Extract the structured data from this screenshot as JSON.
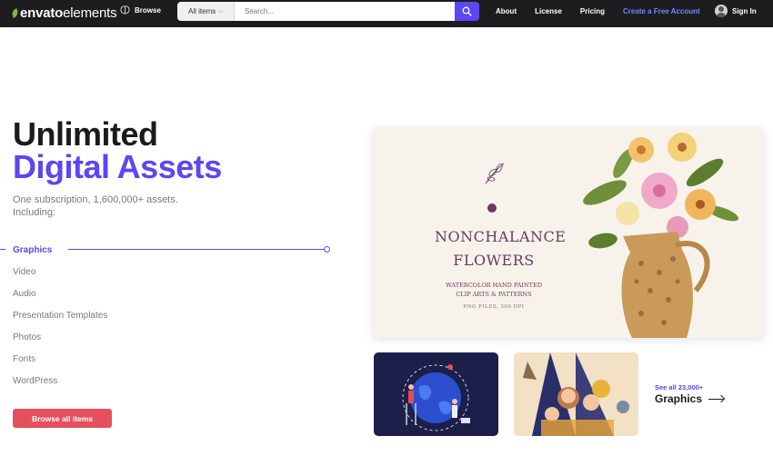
{
  "nav": {
    "logo_bold": "envato",
    "logo_light": "elements",
    "browse": "Browse",
    "search_category": "All items",
    "search_placeholder": "Search...",
    "links": [
      "About",
      "License",
      "Pricing"
    ],
    "create_account": "Create a Free Account",
    "sign_in": "Sign In"
  },
  "hero": {
    "title_line1": "Unlimited",
    "title_line2": "Digital Assets",
    "subtitle": "One subscription, 1,600,000+ assets. Including:",
    "categories": [
      "Graphics",
      "Video",
      "Audio",
      "Presentation Templates",
      "Photos",
      "Fonts",
      "WordPress"
    ],
    "active_category": "Graphics",
    "cta": "Browse all items"
  },
  "feature": {
    "title_line1": "NONCHALANCE",
    "title_line2": "FLOWERS",
    "desc_line1": "WATERCOLOR HAND PAINTED",
    "desc_line2": "CLIP ARTS & PATTERNS",
    "meta": "PNG FILES, 300 DPI"
  },
  "see_all": {
    "small": "See all 23,000+",
    "category": "Graphics"
  },
  "colors": {
    "accent": "#5b47f5",
    "cta": "#e6505c",
    "navbar": "#1d1d1f",
    "logo_green": "#82b541"
  }
}
